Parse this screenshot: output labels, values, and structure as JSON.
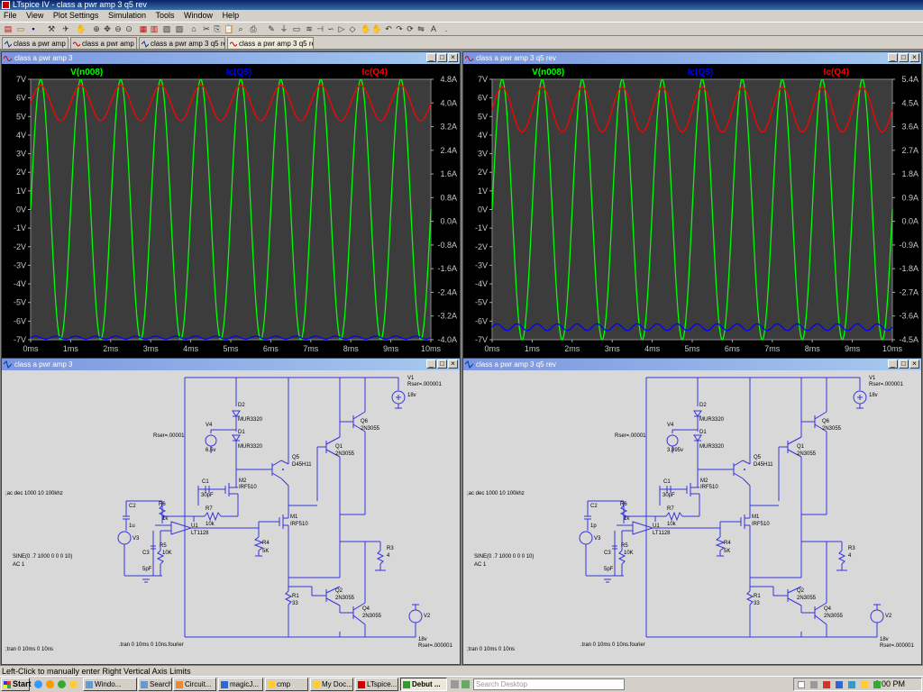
{
  "app": {
    "title": "LTspice IV - class a pwr amp 3 q5 rev"
  },
  "menu": [
    "File",
    "View",
    "Plot Settings",
    "Simulation",
    "Tools",
    "Window",
    "Help"
  ],
  "tabs": [
    {
      "label": "class a pwr amp 3",
      "icon": "schematic-icon",
      "active": false
    },
    {
      "label": "class a pwr amp 3",
      "icon": "waveform-icon",
      "active": false
    },
    {
      "label": "class a pwr amp 3 q5 rev",
      "icon": "schematic-icon",
      "active": false
    },
    {
      "label": "class a pwr amp 3 q5 rev",
      "icon": "waveform-icon",
      "active": true
    }
  ],
  "plots": [
    {
      "title": "class a pwr amp 3",
      "traces": [
        {
          "label": "V(n008)",
          "color": "#00ff00"
        },
        {
          "label": "Ic(Q5)",
          "color": "#0000ff"
        },
        {
          "label": "Ic(Q4)",
          "color": "#ff0000"
        }
      ],
      "left_ticks": [
        "7V",
        "6V",
        "5V",
        "4V",
        "3V",
        "2V",
        "1V",
        "0V",
        "-1V",
        "-2V",
        "-3V",
        "-4V",
        "-5V",
        "-6V",
        "-7V"
      ],
      "right_ticks": [
        "4.8A",
        "4.0A",
        "3.2A",
        "2.4A",
        "1.6A",
        "0.8A",
        "0.0A",
        "-0.8A",
        "-1.6A",
        "-2.4A",
        "-3.2A",
        "-4.0A"
      ],
      "x_ticks": [
        "0ms",
        "1ms",
        "2ms",
        "3ms",
        "4ms",
        "5ms",
        "6ms",
        "7ms",
        "8ms",
        "9ms",
        "10ms"
      ]
    },
    {
      "title": "class a pwr amp 3 q5 rev",
      "traces": [
        {
          "label": "V(n008)",
          "color": "#00ff00"
        },
        {
          "label": "Ic(Q5)",
          "color": "#0000ff"
        },
        {
          "label": "Ic(Q4)",
          "color": "#ff0000"
        }
      ],
      "left_ticks": [
        "7V",
        "6V",
        "5V",
        "4V",
        "3V",
        "2V",
        "1V",
        "0V",
        "-1V",
        "-2V",
        "-3V",
        "-4V",
        "-5V",
        "-6V",
        "-7V"
      ],
      "right_ticks": [
        "5.4A",
        "4.5A",
        "3.6A",
        "2.7A",
        "1.8A",
        "0.9A",
        "0.0A",
        "-0.9A",
        "-1.8A",
        "-2.7A",
        "-3.6A",
        "-4.5A"
      ],
      "x_ticks": [
        "0ms",
        "1ms",
        "2ms",
        "3ms",
        "4ms",
        "5ms",
        "6ms",
        "7ms",
        "8ms",
        "9ms",
        "10ms"
      ]
    }
  ],
  "schematics": [
    {
      "title": "class a pwr amp 3",
      "labels": {
        "V1": "V1",
        "V1_rser": "Rser=.000001",
        "V1_val": "18v",
        "V2": "V2",
        "V2_val": "18v",
        "V2_rser": "Rser=.000001",
        "V3": "V3",
        "V4": "V4",
        "V4_val": "6.5v",
        "V4_rser": "Rser=.00001",
        "D2": "D2",
        "D2_part": "MUR3320",
        "D1": "D1",
        "D1_part": "MUR3320",
        "Q5": "Q5",
        "Q5_part": "D45H11",
        "Q6": "Q6",
        "Q6_part": "2N3055",
        "Q1": "Q1",
        "Q1_part": "2N3055",
        "Q2": "Q2",
        "Q2_part": "2N3055",
        "Q4": "Q4",
        "Q4_part": "2N3055",
        "M2": "M2",
        "M2_part": "IRF510",
        "M1": "M1",
        "M1_part": "IRF510",
        "C1": "C1",
        "C1_val": "30pF",
        "R7": "R7",
        "R7_val": "10k",
        "C2": "C2",
        "C2_val": "1u",
        "R6": "R6",
        "R6_val": "1k",
        "R5": "R5",
        "R5_val": "10K",
        "C3": "C3",
        "C3_val": "5pF",
        "U1": "U1",
        "U1_part": "LT1128",
        "R4": "R4",
        "R4_val": "5K",
        "R3": "R3",
        "R3_val": "4",
        "R1": "R1",
        "R1_val": "33",
        "ac_cmd": ";ac dec 1000 10 100khz",
        "sine": "SINE(0 .7 1000 0 0 0 10)",
        "ac1": "AC 1",
        "tran1": ";tran 0 10ms 0 10ns",
        "tran2": ".tran 0 10ms 0 10ns.fourier"
      }
    },
    {
      "title": "class a pwr amp 3 q5 rev",
      "labels": {
        "V1": "V1",
        "V1_rser": "Rser=.000001",
        "V1_val": "18v",
        "V2": "V2",
        "V2_val": "18v",
        "V2_rser": "Rser=.000001",
        "V3": "V3",
        "V4": "V4",
        "V4_val": "3.895v",
        "V4_rser": "Rser=.00001",
        "D2": "D2",
        "D2_part": "MUR3320",
        "D1": "D1",
        "D1_part": "MUR3320",
        "Q5": "Q5",
        "Q5_part": "D45H11",
        "Q6": "Q6",
        "Q6_part": "2N3055",
        "Q1": "Q1",
        "Q1_part": "2N3055",
        "Q2": "Q2",
        "Q2_part": "2N3055",
        "Q4": "Q4",
        "Q4_part": "2N3055",
        "M2": "M2",
        "M2_part": "IRF510",
        "M1": "M1",
        "M1_part": "IRF510",
        "C1": "C1",
        "C1_val": "30pF",
        "R7": "R7",
        "R7_val": "10k",
        "C2": "C2",
        "C2_val": "1p",
        "R6": "R6",
        "R6_val": "1k",
        "R5": "R5",
        "R5_val": "10K",
        "C3": "C3",
        "C3_val": "5pF",
        "U1": "U1",
        "U1_part": "LT1128",
        "R4": "R4",
        "R4_val": "5K",
        "R3": "R3",
        "R3_val": "4",
        "R1": "R1",
        "R1_val": "33",
        "ac_cmd": ";ac dec 1000 10 100khz",
        "sine": "SINE(0 .7 1000 0 0 0 10)",
        "ac1": "AC 1",
        "tran1": ";tran 0 10ms 0 10ns",
        "tran2": ".tran 0 10ms 0 10ns.fourier"
      }
    }
  ],
  "status": "Left-Click to manually enter Right Vertical Axis Limits",
  "taskbar": {
    "start": "Start",
    "tasks": [
      {
        "label": "Windo...",
        "active": false
      },
      {
        "label": "Search ...",
        "active": false
      },
      {
        "label": "Circuit...",
        "active": false
      },
      {
        "label": "magicJ...",
        "active": false
      },
      {
        "label": "cmp",
        "active": false
      },
      {
        "label": "My Doc...",
        "active": false
      },
      {
        "label": "LTspice...",
        "active": false
      },
      {
        "label": "Debut ...",
        "active": true
      }
    ],
    "search_placeholder": "Search Desktop",
    "clock": "2:00 PM"
  },
  "chart_data": [
    {
      "type": "line",
      "title": "class a pwr amp 3",
      "x_range_ms": [
        0,
        10
      ],
      "y_left_range_V": [
        -7,
        7
      ],
      "y_right_range_A": [
        -4.0,
        4.8
      ],
      "grid": false,
      "series": [
        {
          "name": "V(n008)",
          "axis": "left",
          "kind": "sine",
          "freq_khz": 1,
          "amplitude_V": 7,
          "offset_V": 0
        },
        {
          "name": "Ic(Q4)",
          "axis": "right",
          "kind": "sine",
          "freq_khz": 1,
          "min_A": 3.4,
          "max_A": 4.6
        },
        {
          "name": "Ic(Q5)",
          "axis": "right",
          "kind": "sine",
          "freq_khz": 2,
          "min_A": -3.98,
          "max_A": -3.88
        }
      ]
    },
    {
      "type": "line",
      "title": "class a pwr amp 3 q5 rev",
      "x_range_ms": [
        0,
        10
      ],
      "y_left_range_V": [
        -7,
        7
      ],
      "y_right_range_A": [
        -4.5,
        5.4
      ],
      "grid": false,
      "series": [
        {
          "name": "V(n008)",
          "axis": "left",
          "kind": "sine",
          "freq_khz": 1,
          "amplitude_V": 7,
          "offset_V": 0
        },
        {
          "name": "Ic(Q4)",
          "axis": "right",
          "kind": "sine",
          "freq_khz": 1,
          "min_A": 3.4,
          "max_A": 5.1
        },
        {
          "name": "Ic(Q5)",
          "axis": "right",
          "kind": "sine",
          "freq_khz": 2,
          "min_A": -4.15,
          "max_A": -3.9
        }
      ]
    }
  ]
}
